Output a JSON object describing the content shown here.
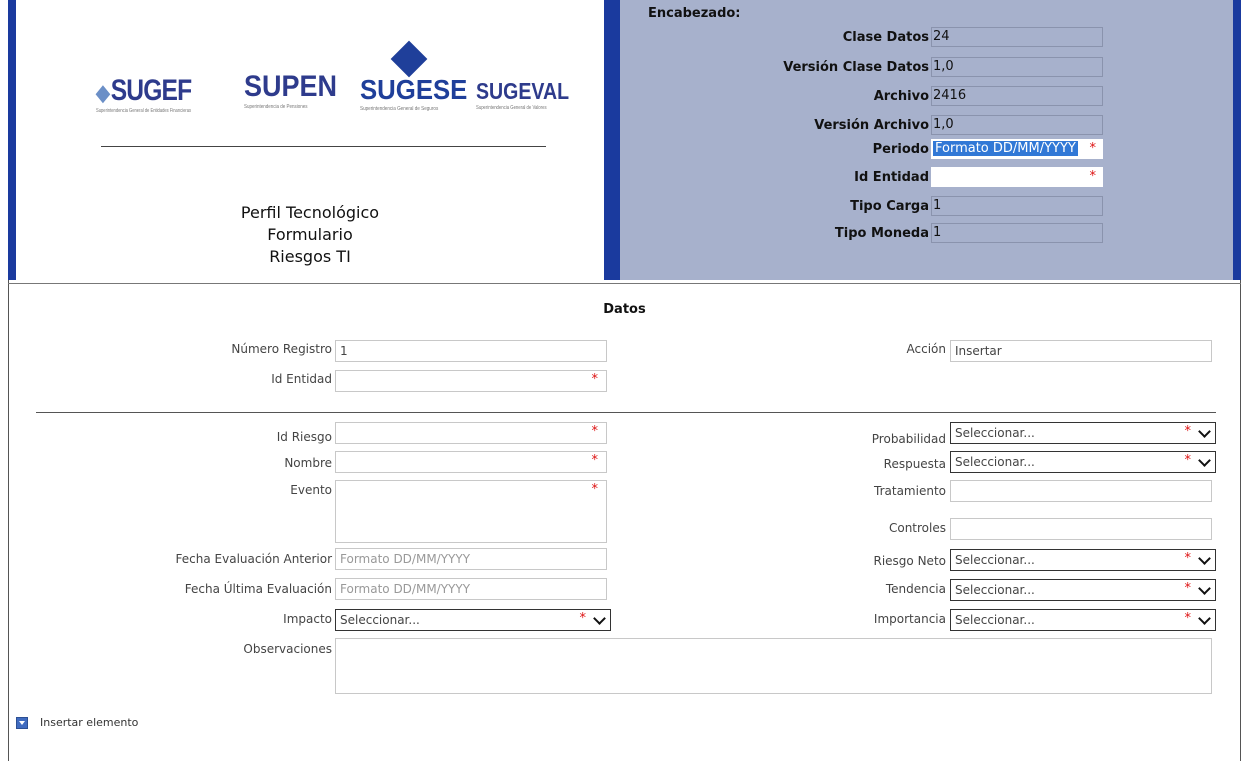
{
  "header": {
    "logos": {
      "sugef": "SUGEF",
      "sugef_sub": "Superintendencia General de Entidades Financieras",
      "supen": "SUPEN",
      "supen_sub": "Superintendencia de Pensiones",
      "sugese": "SUGESE",
      "sugese_sub": "Superintendencia General de Seguros",
      "sugeval": "SUGEVAL",
      "sugeval_sub": "Superintendencia General de Valores"
    },
    "title_lines": [
      "Perfil Tecnológico",
      "Formulario",
      "Riesgos TI"
    ],
    "encabezado": {
      "title": "Encabezado:",
      "rows": [
        {
          "label": "Clase Datos",
          "value": "24"
        },
        {
          "label": "Versión Clase Datos",
          "value": "1,0"
        },
        {
          "label": "Archivo",
          "value": "2416"
        },
        {
          "label": "Versión Archivo",
          "value": "1,0"
        },
        {
          "label": "Periodo",
          "value": "Formato DD/MM/YYYY"
        },
        {
          "label": "Id Entidad",
          "value": ""
        },
        {
          "label": "Tipo Carga",
          "value": "1"
        },
        {
          "label": "Tipo Moneda",
          "value": "1"
        }
      ]
    }
  },
  "datos": {
    "title": "Datos",
    "numero_registro": {
      "label": "Número Registro",
      "value": "1"
    },
    "accion": {
      "label": "Acción",
      "value": "Insertar"
    },
    "id_entidad": {
      "label": "Id Entidad",
      "value": ""
    },
    "id_riesgo": {
      "label": "Id Riesgo",
      "value": ""
    },
    "nombre": {
      "label": "Nombre",
      "value": ""
    },
    "evento": {
      "label": "Evento",
      "value": ""
    },
    "fecha_eval_anterior": {
      "label": "Fecha Evaluación Anterior",
      "placeholder": "Formato DD/MM/YYYY"
    },
    "fecha_ultima_eval": {
      "label": "Fecha Última Evaluación",
      "placeholder": "Formato DD/MM/YYYY"
    },
    "impacto": {
      "label": "Impacto",
      "value": "Seleccionar..."
    },
    "observaciones": {
      "label": "Observaciones",
      "value": ""
    },
    "probabilidad": {
      "label": "Probabilidad",
      "value": "Seleccionar..."
    },
    "respuesta": {
      "label": "Respuesta",
      "value": "Seleccionar..."
    },
    "tratamiento": {
      "label": "Tratamiento",
      "value": ""
    },
    "controles": {
      "label": "Controles",
      "value": ""
    },
    "riesgo_neto": {
      "label": "Riesgo Neto",
      "value": "Seleccionar..."
    },
    "tendencia": {
      "label": "Tendencia",
      "value": "Seleccionar..."
    },
    "importancia": {
      "label": "Importancia",
      "value": "Seleccionar..."
    },
    "required_mark": "*"
  },
  "footer": {
    "insert_label": "Insertar elemento"
  },
  "colors": {
    "header_bg": "#a7b1cc",
    "border_blue": "#1a3a9e",
    "required": "#dd1111"
  }
}
